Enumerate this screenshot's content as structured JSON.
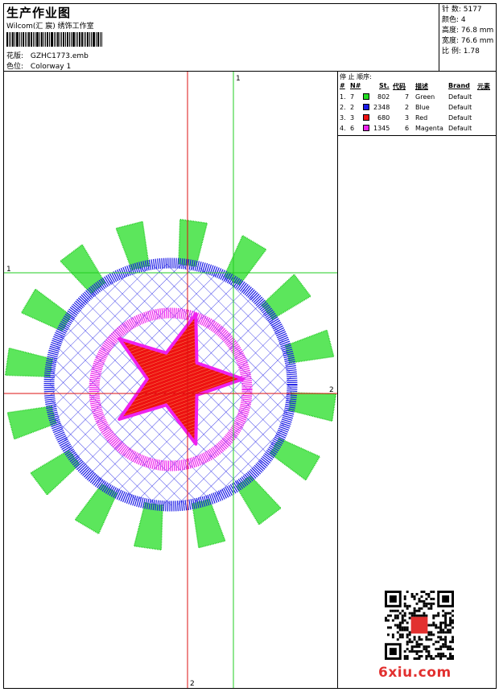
{
  "header": {
    "title": "生产作业图",
    "studio": "Wilcom(汇 宸) 绣饰工作室",
    "design_label": "花版:",
    "design_value": "GZHC1773.emb",
    "color_label": "色位:",
    "color_value": "Colorway 1"
  },
  "stats": {
    "stitches": "针 数: 5177",
    "colors": "颜色: 4",
    "height": "高度: 76.8 mm",
    "width": "宽度: 76.6 mm",
    "ratio": "比 例: 1.78"
  },
  "stops": {
    "title": "停 止 顺序:",
    "headers": [
      "#",
      "N#",
      "St.",
      "代码",
      "描述",
      "Brand",
      "元素"
    ],
    "rows": [
      {
        "num": "1.",
        "n": "7",
        "st": "802",
        "code": "7",
        "desc": "Green",
        "brand": "Default",
        "color": "#22dd22"
      },
      {
        "num": "2.",
        "n": "2",
        "st": "2348",
        "code": "2",
        "desc": "Blue",
        "brand": "Default",
        "color": "#1a1ae6"
      },
      {
        "num": "3.",
        "n": "3",
        "st": "680",
        "code": "3",
        "desc": "Red",
        "brand": "Default",
        "color": "#ee1111"
      },
      {
        "num": "4.",
        "n": "6",
        "st": "1345",
        "code": "6",
        "desc": "Magenta",
        "brand": "Default",
        "color": "#ee22ee"
      }
    ]
  },
  "axes": {
    "green_top": "1",
    "green_left": "1",
    "red_right": "2",
    "red_bottom": "2"
  },
  "watermark": {
    "brand": "6xiu.com"
  }
}
